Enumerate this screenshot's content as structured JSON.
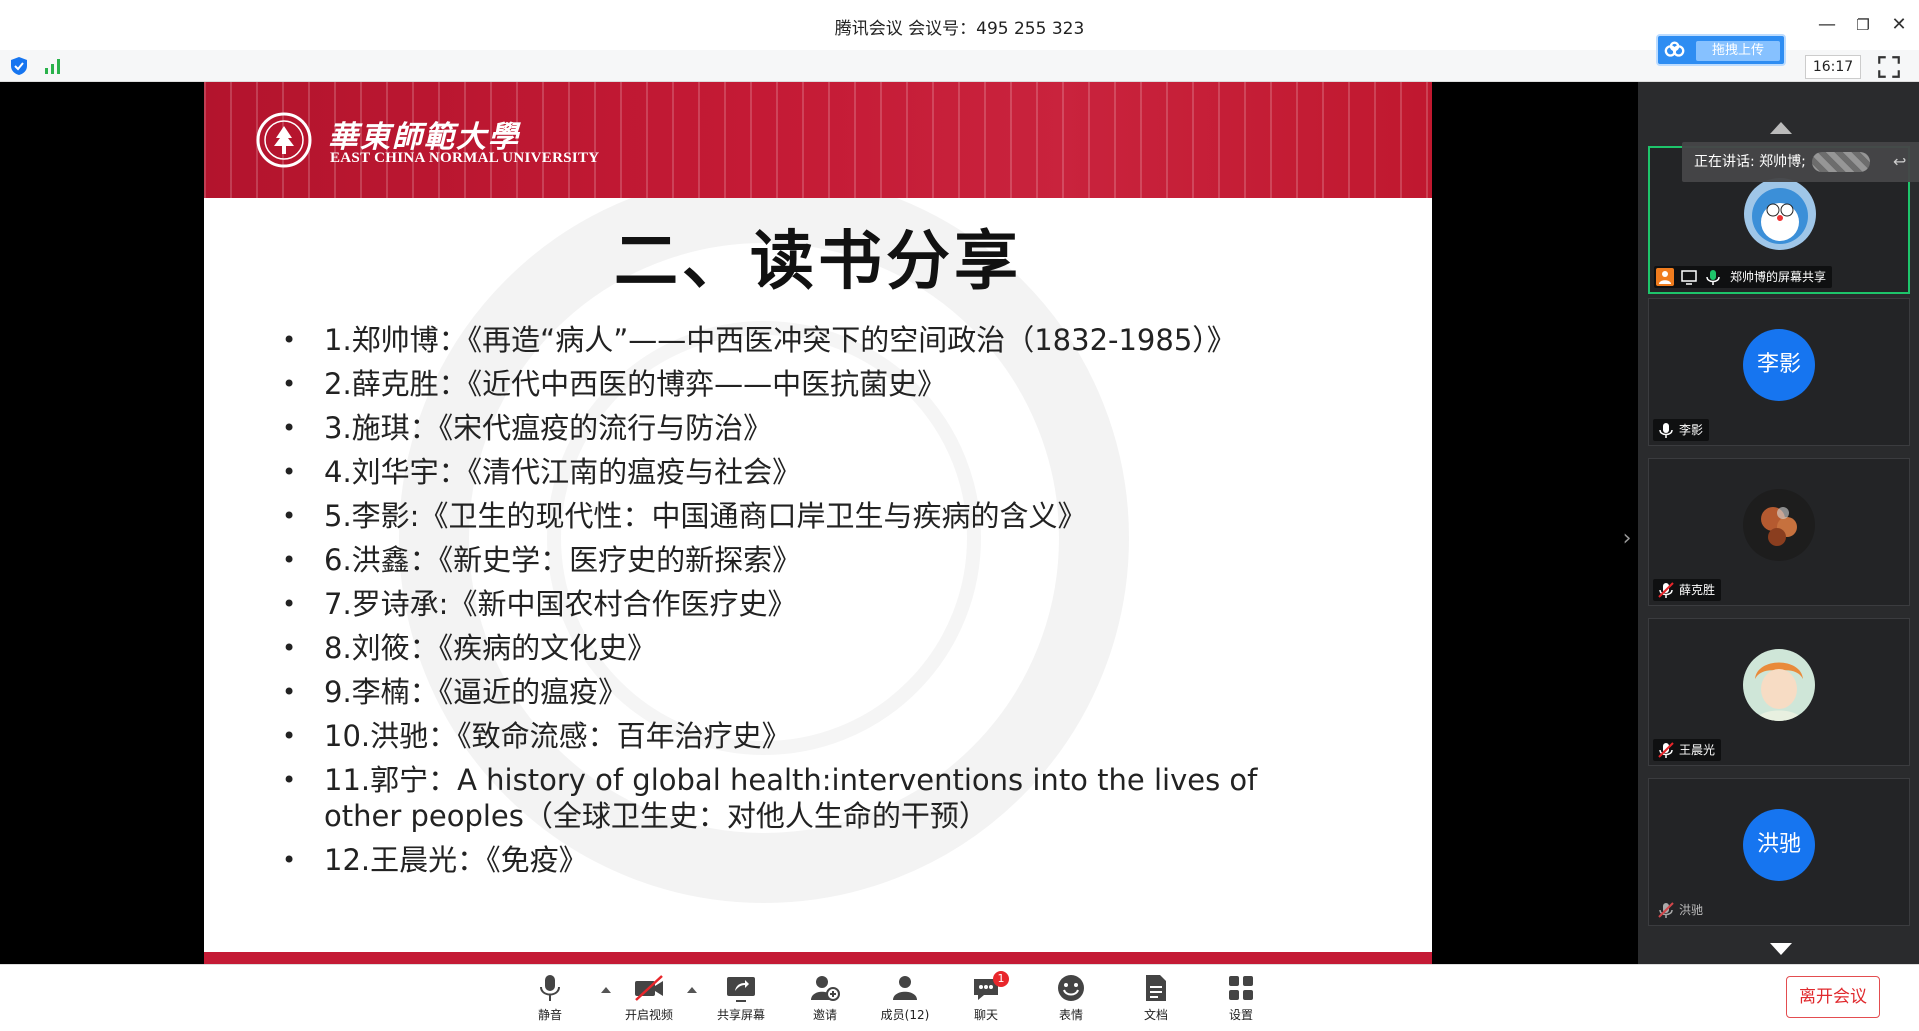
{
  "window": {
    "title": "腾讯会议 会议号：495 255 323",
    "upload_label": "拖拽上传",
    "clock": "16:17"
  },
  "slide": {
    "university_cn": "華東師範大學",
    "university_en": "EAST CHINA NORMAL UNIVERSITY",
    "title": "二、读书分享",
    "items": [
      "1.郑帅博：《再造“病人”——中西医冲突下的空间政治（1832-1985）》",
      "2.薛克胜：《近代中西医的博弈——中医抗菌史》",
      "3.施琪：《宋代瘟疫的流行与防治》",
      "4.刘华宇：《清代江南的瘟疫与社会》",
      "5.李影:《卫生的现代性：中国通商口岸卫生与疾病的含义》",
      "6.洪鑫：《新史学：医疗史的新探索》",
      "7.罗诗承:《新中国农村合作医疗史》",
      "8.刘筱：《疾病的文化史》",
      "9.李楠：《逼近的瘟疫》",
      "10.洪驰：《致命流感：百年治疗史》",
      "11.郭宁：A history of global health:interventions into the lives of other peoples（全球卫生史：对他人生命的干预）",
      "12.王晨光：《免疫》"
    ]
  },
  "panel": {
    "speaking_prefix": "正在讲话: 郑帅博;",
    "tiles": [
      {
        "label": "郑帅博的屏幕共享",
        "avatar_text": ""
      },
      {
        "label": "李影",
        "avatar_text": "李影"
      },
      {
        "label": "薛克胜",
        "avatar_text": ""
      },
      {
        "label": "王晨光",
        "avatar_text": ""
      },
      {
        "label": "洪驰",
        "avatar_text": "洪驰"
      }
    ]
  },
  "toolbar": {
    "mute": "静音",
    "video": "开启视频",
    "share": "共享屏幕",
    "invite": "邀请",
    "members": "成员(12)",
    "chat": "聊天",
    "chat_badge": "1",
    "emoji": "表情",
    "docs": "文档",
    "settings": "设置",
    "leave": "离开会议"
  },
  "colors": {
    "brand_red": "#c41a35",
    "accent_blue": "#1675f0",
    "active_green": "#1ec56b",
    "leave_red": "#e0292d"
  }
}
